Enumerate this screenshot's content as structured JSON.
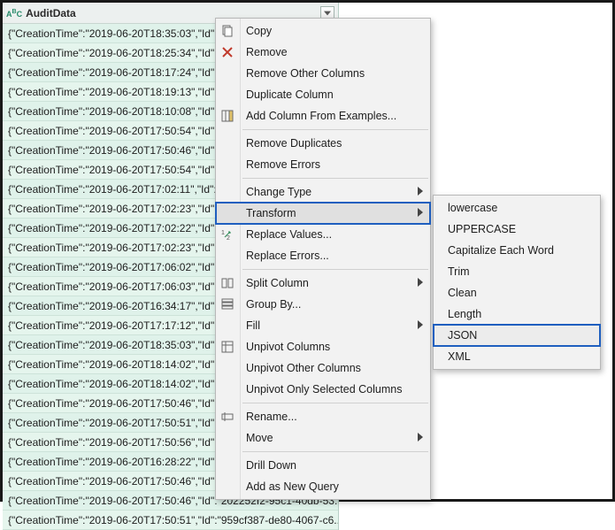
{
  "column": {
    "name": "AuditData",
    "type_icon": {
      "top": "A",
      "bottom": "C",
      "sup": "B"
    }
  },
  "rows": [
    "{\"CreationTime\":\"2019-06-20T18:35:03\",\"Id\":\"1c...",
    "{\"CreationTime\":\"2019-06-20T18:25:34\",\"Id\":\"d0...",
    "{\"CreationTime\":\"2019-06-20T18:17:24\",\"Id\":\"30...",
    "{\"CreationTime\":\"2019-06-20T18:19:13\",\"Id\":\"be...",
    "{\"CreationTime\":\"2019-06-20T18:10:08\",\"Id\":\"a5...",
    "{\"CreationTime\":\"2019-06-20T17:50:54\",\"Id\":\"97...",
    "{\"CreationTime\":\"2019-06-20T17:50:46\",\"Id\":\"f8...",
    "{\"CreationTime\":\"2019-06-20T17:50:54\",\"Id\":\"f1...",
    "{\"CreationTime\":\"2019-06-20T17:02:11\",\"Id\":\"ed...",
    "{\"CreationTime\":\"2019-06-20T17:02:23\",\"Id\":\"4a...",
    "{\"CreationTime\":\"2019-06-20T17:02:22\",\"Id\":\"b3...",
    "{\"CreationTime\":\"2019-06-20T17:02:23\",\"Id\":\"2f...",
    "{\"CreationTime\":\"2019-06-20T17:06:02\",\"Id\":\"69...",
    "{\"CreationTime\":\"2019-06-20T17:06:03\",\"Id\":\"fd...",
    "{\"CreationTime\":\"2019-06-20T16:34:17\",\"Id\":\"fe...",
    "{\"CreationTime\":\"2019-06-20T17:17:12\",\"Id\":\"ef...",
    "{\"CreationTime\":\"2019-06-20T18:35:03\",\"Id\":\"7a...",
    "{\"CreationTime\":\"2019-06-20T18:14:02\",\"Id\":\"91...",
    "{\"CreationTime\":\"2019-06-20T18:14:02\",\"Id\":\"ee...",
    "{\"CreationTime\":\"2019-06-20T17:50:46\",\"Id\":\"2e...",
    "{\"CreationTime\":\"2019-06-20T17:50:51\",\"Id\":\"95...",
    "{\"CreationTime\":\"2019-06-20T17:50:56\",\"Id\":\"3c...",
    "{\"CreationTime\":\"2019-06-20T16:28:22\",\"Id\":\"74...",
    "{\"CreationTime\":\"2019-06-20T17:50:46\",\"Id\":\"9a...",
    "{\"CreationTime\":\"2019-06-20T17:50:46\",\"Id\":\"202252f2-95c1-40db-53...",
    "{\"CreationTime\":\"2019-06-20T17:50:51\",\"Id\":\"959cf387-de80-4067-c6..."
  ],
  "menu": {
    "copy": "Copy",
    "remove": "Remove",
    "remove_other": "Remove Other Columns",
    "duplicate": "Duplicate Column",
    "add_from_examples": "Add Column From Examples...",
    "remove_dup": "Remove Duplicates",
    "remove_err": "Remove Errors",
    "change_type": "Change Type",
    "transform": "Transform",
    "replace_values": "Replace Values...",
    "replace_errors": "Replace Errors...",
    "split_column": "Split Column",
    "group_by": "Group By...",
    "fill": "Fill",
    "unpivot": "Unpivot Columns",
    "unpivot_other": "Unpivot Other Columns",
    "unpivot_selected": "Unpivot Only Selected Columns",
    "rename": "Rename...",
    "move": "Move",
    "drill_down": "Drill Down",
    "add_new_query": "Add as New Query"
  },
  "submenu": {
    "lowercase": "lowercase",
    "uppercase": "UPPERCASE",
    "capitalize": "Capitalize Each Word",
    "trim": "Trim",
    "clean": "Clean",
    "length": "Length",
    "json": "JSON",
    "xml": "XML"
  }
}
